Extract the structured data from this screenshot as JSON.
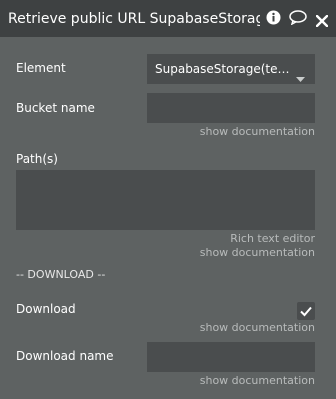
{
  "header": {
    "title": "Retrieve public URL SupabaseStorage",
    "icons": [
      "info-icon",
      "comment-icon",
      "close-icon"
    ]
  },
  "fields": {
    "element": {
      "label": "Element",
      "value": "SupabaseStorage(testi..."
    },
    "bucket_name": {
      "label": "Bucket name",
      "value": "",
      "doc_link": "show documentation"
    },
    "paths": {
      "label": "Path(s)",
      "value": "",
      "rich_text_link": "Rich text editor",
      "doc_link": "show documentation"
    },
    "section_download": "-- DOWNLOAD --",
    "download": {
      "label": "Download",
      "checked": true,
      "doc_link": "show documentation"
    },
    "download_name": {
      "label": "Download name",
      "value": "",
      "doc_link": "show documentation"
    }
  },
  "colors": {
    "panel": "#5e6262",
    "titlebar": "#3e4142",
    "input": "#4a4d4e",
    "link": "#b8bbbb"
  }
}
